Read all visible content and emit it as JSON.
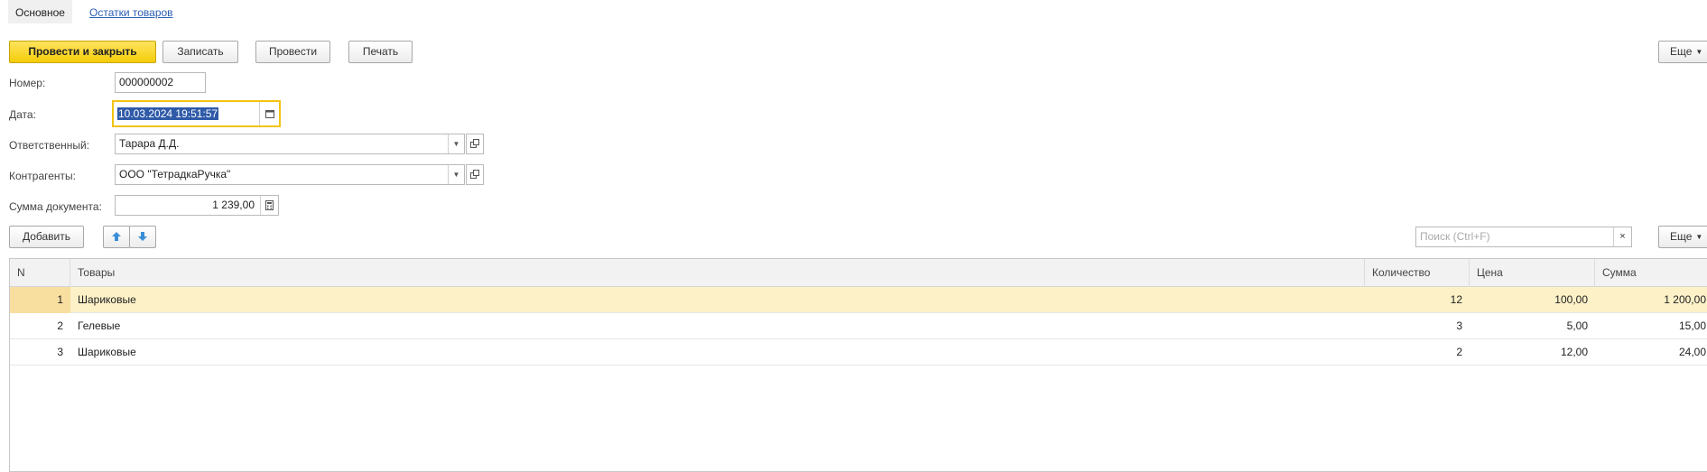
{
  "tabs": {
    "main": "Основное",
    "stock": "Остатки товаров"
  },
  "toolbar": {
    "post_close": "Провести и закрыть",
    "save": "Записать",
    "post": "Провести",
    "print": "Печать",
    "more": "Еще"
  },
  "form": {
    "number_label": "Номер:",
    "number_value": "000000002",
    "date_label": "Дата:",
    "date_value": "10.03.2024 19:51:57",
    "responsible_label": "Ответственный:",
    "responsible_value": "Тарара Д.Д.",
    "counterparty_label": "Контрагенты:",
    "counterparty_value": "ООО \"ТетрадкаРучка\"",
    "sum_label": "Сумма документа:",
    "sum_value": "1 239,00"
  },
  "table_toolbar": {
    "add": "Добавить",
    "search_placeholder": "Поиск (Ctrl+F)",
    "more": "Еще"
  },
  "table": {
    "columns": [
      "N",
      "Товары",
      "Количество",
      "Цена",
      "Сумма"
    ],
    "rows": [
      {
        "n": "1",
        "item": "Шариковые",
        "qty": "12",
        "price": "100,00",
        "sum": "1 200,00"
      },
      {
        "n": "2",
        "item": "Гелевые",
        "qty": "3",
        "price": "5,00",
        "sum": "15,00"
      },
      {
        "n": "3",
        "item": "Шариковые",
        "qty": "2",
        "price": "12,00",
        "sum": "24,00"
      }
    ]
  }
}
